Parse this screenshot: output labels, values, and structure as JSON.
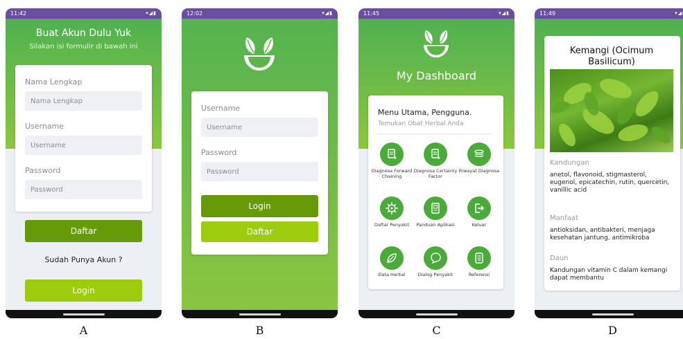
{
  "colors": {
    "status_bar": "#6b4ea1",
    "hero_green": "#4fb151",
    "button_dark": "#679a09",
    "button_light": "#9ccc0c",
    "icon_circle": "#4aab3a"
  },
  "phone_a": {
    "status_time": "11:42",
    "title": "Buat Akun Dulu Yuk",
    "subtitle": "Silakan isi formulir di bawah ini",
    "fields": [
      {
        "label": "Nama Lengkap",
        "placeholder": "Nama Lengkap"
      },
      {
        "label": "Username",
        "placeholder": "Username"
      },
      {
        "label": "Password",
        "placeholder": "Password"
      }
    ],
    "register_button": "Daftar",
    "have_account_text": "Sudah Punya Akun ?",
    "login_button": "Login",
    "caption": "A"
  },
  "phone_b": {
    "status_time": "12:02",
    "fields": [
      {
        "label": "Username",
        "placeholder": "Username"
      },
      {
        "label": "Password",
        "placeholder": "Password"
      }
    ],
    "login_button": "Login",
    "register_button": "Daftar",
    "caption": "B"
  },
  "phone_c": {
    "status_time": "11:45",
    "title": "My Dashboard",
    "menu_heading": "Menu Utama, Pengguna.",
    "menu_subheading": "Temukan Obat Herbal Anda",
    "menu_items": [
      {
        "label": "Diagnosa Forward Chaining",
        "icon": "diagnosis-doc-icon"
      },
      {
        "label": "Diagnosa Certainty Factor",
        "icon": "diagnosis-doc-icon"
      },
      {
        "label": "Riwayat Diagnosa",
        "icon": "history-stack-icon"
      },
      {
        "label": "Daftar Penyakit",
        "icon": "virus-icon"
      },
      {
        "label": "Panduan Aplikasi",
        "icon": "guide-book-icon"
      },
      {
        "label": "Keluar",
        "icon": "logout-icon"
      },
      {
        "label": "Data Herbal",
        "icon": "leaf-icon"
      },
      {
        "label": "Dialog Penyakit",
        "icon": "chat-bubble-icon"
      },
      {
        "label": "Referensi",
        "icon": "reference-book-icon"
      }
    ],
    "caption": "C"
  },
  "phone_d": {
    "status_time": "11:49",
    "title": "Kemangi (Ocimum Basilicum)",
    "sections": [
      {
        "heading": "Kandungan",
        "text": "anetol, flavonoid, stigmasterol, eugenol, epicatechin, rutin, quercetin, vanillic acid"
      },
      {
        "heading": "Manfaat",
        "text": "antioksidan, antibakteri, menjaga kesehatan jantung, antimikroba"
      },
      {
        "heading": "Daun",
        "text": "Kandungan vitamin C dalam kemangi dapat membantu"
      }
    ],
    "caption": "D"
  }
}
